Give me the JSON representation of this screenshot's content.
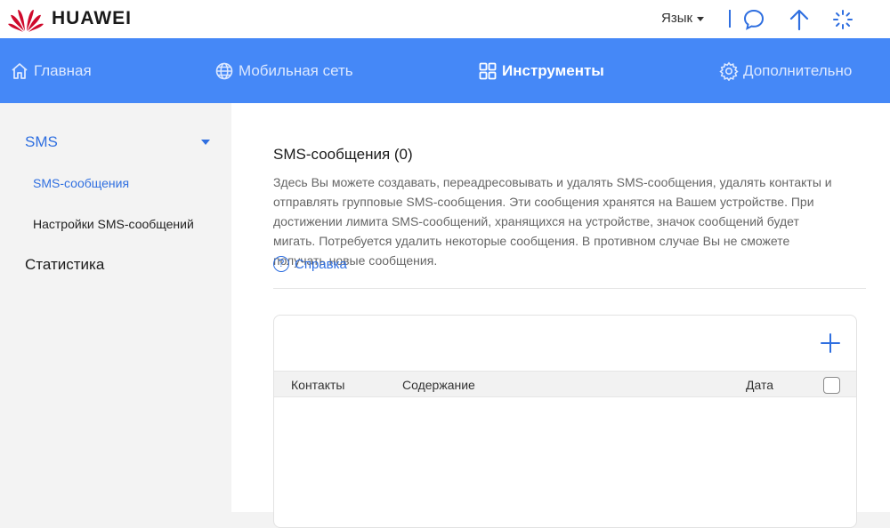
{
  "header": {
    "brand": "HUAWEI",
    "language_label": "Язык",
    "icons": [
      "chat-bubble-icon",
      "upload-arrow-icon",
      "loading-spinner-icon"
    ]
  },
  "nav": {
    "items": [
      {
        "label": "Главная",
        "icon": "home-icon",
        "active": false
      },
      {
        "label": "Мобильная сеть",
        "icon": "globe-icon",
        "active": false
      },
      {
        "label": "Инструменты",
        "icon": "grid-icon",
        "active": true
      },
      {
        "label": "Дополнительно",
        "icon": "gear-icon",
        "active": false
      }
    ]
  },
  "sidebar": {
    "group_sms": "SMS",
    "items": [
      {
        "label": "SMS-сообщения",
        "active": true
      },
      {
        "label": "Настройки SMS-сообщений",
        "active": false
      }
    ],
    "group_stats": "Статистика"
  },
  "main": {
    "title": "SMS-сообщения (0)",
    "description": "Здесь Вы можете создавать, переадресовывать и удалять SMS-сообщения, удалять контакты и отправлять групповые SMS-сообщения. Эти сообщения хранятся на Вашем устройстве. При достижении лимита SMS-сообщений, хранящихся на устройстве, значок сообщений будет мигать. Потребуется удалить некоторые сообщения. В противном случае Вы не сможете получать новые сообщения.",
    "help_label": "Справка",
    "help_icon_glyph": "?",
    "table": {
      "columns": [
        "Контакты",
        "Содержание",
        "Дата"
      ],
      "rows": []
    }
  },
  "colors": {
    "accent": "#4588f7",
    "link": "#2f6fe0",
    "brand_red": "#cf0a2c"
  }
}
